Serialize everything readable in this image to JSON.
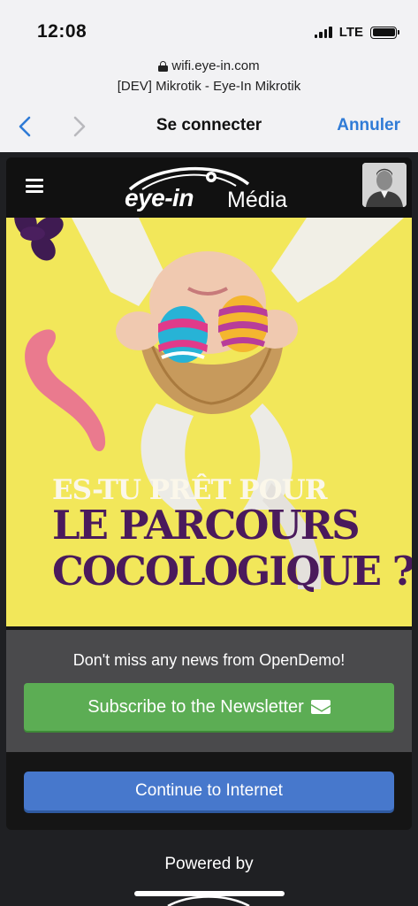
{
  "status_bar": {
    "time": "12:08",
    "network": "LTE"
  },
  "browser_sheet": {
    "url": "wifi.eye-in.com",
    "page_title": "[DEV] Mikrotik - Eye-In Mikrotik",
    "title": "Se connecter",
    "cancel_label": "Annuler",
    "accent_color": "#2f7bd6"
  },
  "portal": {
    "logo": {
      "brand": "eye-in",
      "suffix": "Média"
    },
    "banner": {
      "headline_small": "ES-TU PRÊT POUR",
      "headline_big": "LE PARCOURS\nCOCOLOGIQUE ?",
      "background_color": "#f2e75a",
      "headline_color": "#4a1a5c"
    },
    "newsletter": {
      "text": "Don't miss any news from OpenDemo!",
      "button_label": "Subscribe to the Newsletter",
      "button_color": "#5cad54"
    },
    "continue_label": "Continue to Internet",
    "continue_color": "#4778cc",
    "powered_by": "Powered by"
  }
}
